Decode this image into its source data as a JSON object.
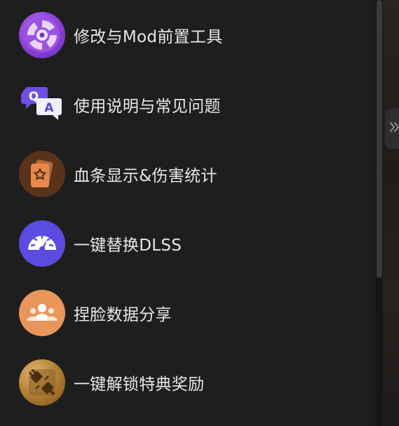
{
  "menu": {
    "items": [
      {
        "label": "修改与Mod前置工具",
        "icon": "mod-tool-icon",
        "color": "#8a3fd6"
      },
      {
        "label": "使用说明与常见问题",
        "icon": "qa-icon",
        "color": "#6a4fe0"
      },
      {
        "label": "血条显示&伤害统计",
        "icon": "card-star-icon",
        "color": "#6b3a1e"
      },
      {
        "label": "一键替换DLSS",
        "icon": "speedometer-icon",
        "color": "#5f4de0"
      },
      {
        "label": "捏脸数据分享",
        "icon": "people-icon",
        "color": "#e89a5c"
      },
      {
        "label": "一键解锁特典奖励",
        "icon": "unlock-plug-icon",
        "color": "#a8742b"
      }
    ]
  },
  "collapse_toggle": {
    "icon": "double-chevron-right-icon"
  }
}
